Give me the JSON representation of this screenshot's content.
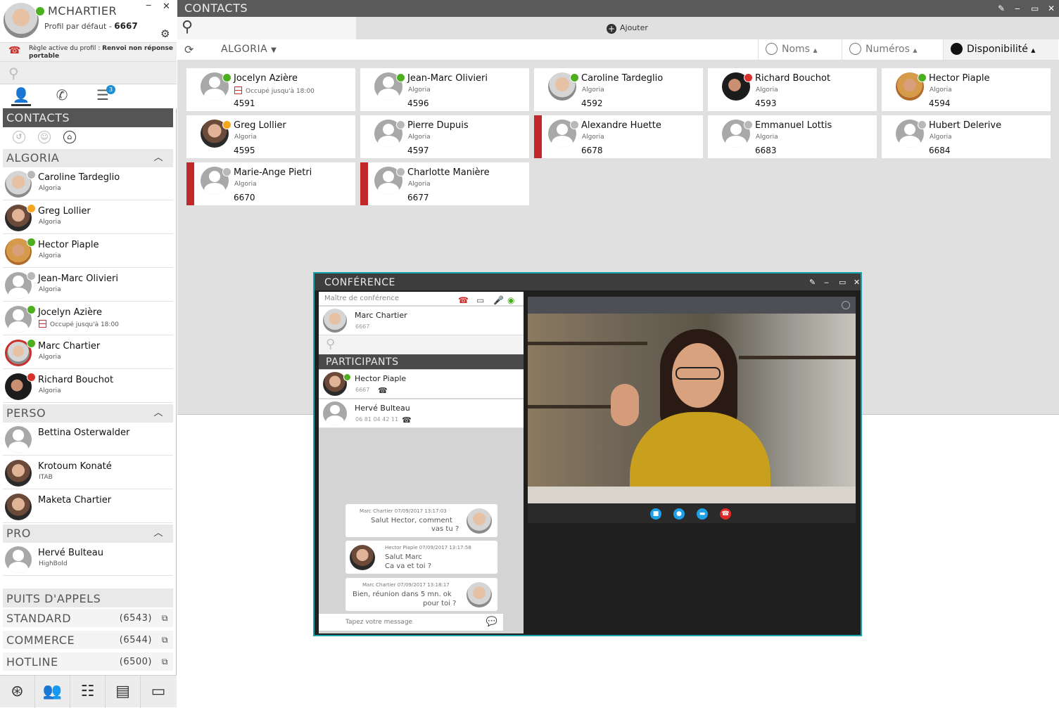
{
  "profile": {
    "username": "MCHARTIER",
    "profile_label": "Profil par défaut - ",
    "extension": "6667",
    "rule_prefix": "Règle active du profil : ",
    "rule_value": "Renvoi non réponse",
    "rule_suffix": "portable",
    "status_color": "#4caf1f"
  },
  "sidebar": {
    "section_title": "CONTACTS",
    "groups": [
      {
        "name": "ALGORIA",
        "contacts": [
          {
            "name": "Caroline Tardeglio",
            "sub": "Algoria",
            "status": "grey"
          },
          {
            "name": "Greg Lollier",
            "sub": "Algoria",
            "status": "orange"
          },
          {
            "name": "Hector Piaple",
            "sub": "Algoria",
            "status": "green"
          },
          {
            "name": "Jean-Marc Olivieri",
            "sub": "Algoria",
            "status": "grey"
          },
          {
            "name": "Jocelyn Azière",
            "sub": "Occupé jusqu'à 18:00",
            "status": "green"
          },
          {
            "name": "Marc Chartier",
            "sub": "Algoria",
            "status": "green"
          },
          {
            "name": "Richard Bouchot",
            "sub": "Algoria",
            "status": "red"
          }
        ]
      },
      {
        "name": "PERSO",
        "contacts": [
          {
            "name": "Bettina Osterwalder",
            "sub": ""
          },
          {
            "name": "Krotoum Konaté",
            "sub": "ITAB"
          },
          {
            "name": "Maketa Chartier",
            "sub": ""
          }
        ]
      },
      {
        "name": "PRO",
        "contacts": [
          {
            "name": "Hervé Bulteau",
            "sub": "HighBold"
          }
        ]
      }
    ],
    "call_pits_title": "PUITS D'APPELS",
    "call_pits": [
      {
        "name": "STANDARD",
        "number": "(6543)"
      },
      {
        "name": "COMMERCE",
        "number": "(6544)"
      },
      {
        "name": "HOTLINE",
        "number": "(6500)"
      }
    ],
    "tabs_badge": "3"
  },
  "main": {
    "title": "CONTACTS",
    "add_label": "Ajouter",
    "directory": "ALGORIA",
    "sort_names": "Noms",
    "sort_numbers": "Numéros",
    "sort_availability": "Disponibilité",
    "cards": [
      {
        "name": "Jocelyn Azière",
        "sub": "Occupé jusqu'à 18:00",
        "number": "4591",
        "status": "green"
      },
      {
        "name": "Jean-Marc Olivieri",
        "sub": "Algoria",
        "number": "4596",
        "status": "green"
      },
      {
        "name": "Caroline Tardeglio",
        "sub": "Algoria",
        "number": "4592",
        "status": "green"
      },
      {
        "name": "Richard Bouchot",
        "sub": "Algoria",
        "number": "4593",
        "status": "red"
      },
      {
        "name": "Hector Piaple",
        "sub": "Algoria",
        "number": "4594",
        "status": "green"
      },
      {
        "name": "Greg Lollier",
        "sub": "Algoria",
        "number": "4595",
        "status": "orange"
      },
      {
        "name": "Pierre Dupuis",
        "sub": "Algoria",
        "number": "4597",
        "status": "grey"
      },
      {
        "name": "Alexandre Huette",
        "sub": "Algoria",
        "number": "6678",
        "status": "grey"
      },
      {
        "name": "Emmanuel Lottis",
        "sub": "Algoria",
        "number": "6683",
        "status": "grey"
      },
      {
        "name": "Hubert Delerive",
        "sub": "Algoria",
        "number": "6684",
        "status": "grey"
      },
      {
        "name": "Marie-Ange Pietri",
        "sub": "Algoria",
        "number": "6670",
        "status": "grey"
      },
      {
        "name": "Charlotte Manière",
        "sub": "Algoria",
        "number": "6677",
        "status": "grey"
      }
    ]
  },
  "conference": {
    "title": "CONFÉRENCE",
    "master_label": "Maître de conférence",
    "master": {
      "name": "Marc Chartier",
      "ext": "6667"
    },
    "participants_title": "PARTICIPANTS",
    "participants": [
      {
        "name": "Hector Piaple",
        "ext": "6667"
      },
      {
        "name": "Hervé Bulteau",
        "ext": "06 81 04 42 11"
      }
    ],
    "messages": [
      {
        "meta": "Marc Chartier 07/09/2017 13:17:03",
        "line1": "Salut Hector, comment",
        "line2": "vas tu ?"
      },
      {
        "meta": "Hector Piaple 07/09/2017 13:17:58",
        "line1": "Salut Marc",
        "line2": "Ca va et toi ?"
      },
      {
        "meta": "Marc Chartier 07/09/2017 13:18:17",
        "line1": "Bien, réunion dans 5 mn. ok",
        "line2": "pour toi ?"
      }
    ],
    "input_placeholder": "Tapez votre message"
  },
  "colors": {
    "accent": "#18a3b0",
    "busy_red": "#c0282a",
    "title_bar": "#5a5a5a"
  }
}
